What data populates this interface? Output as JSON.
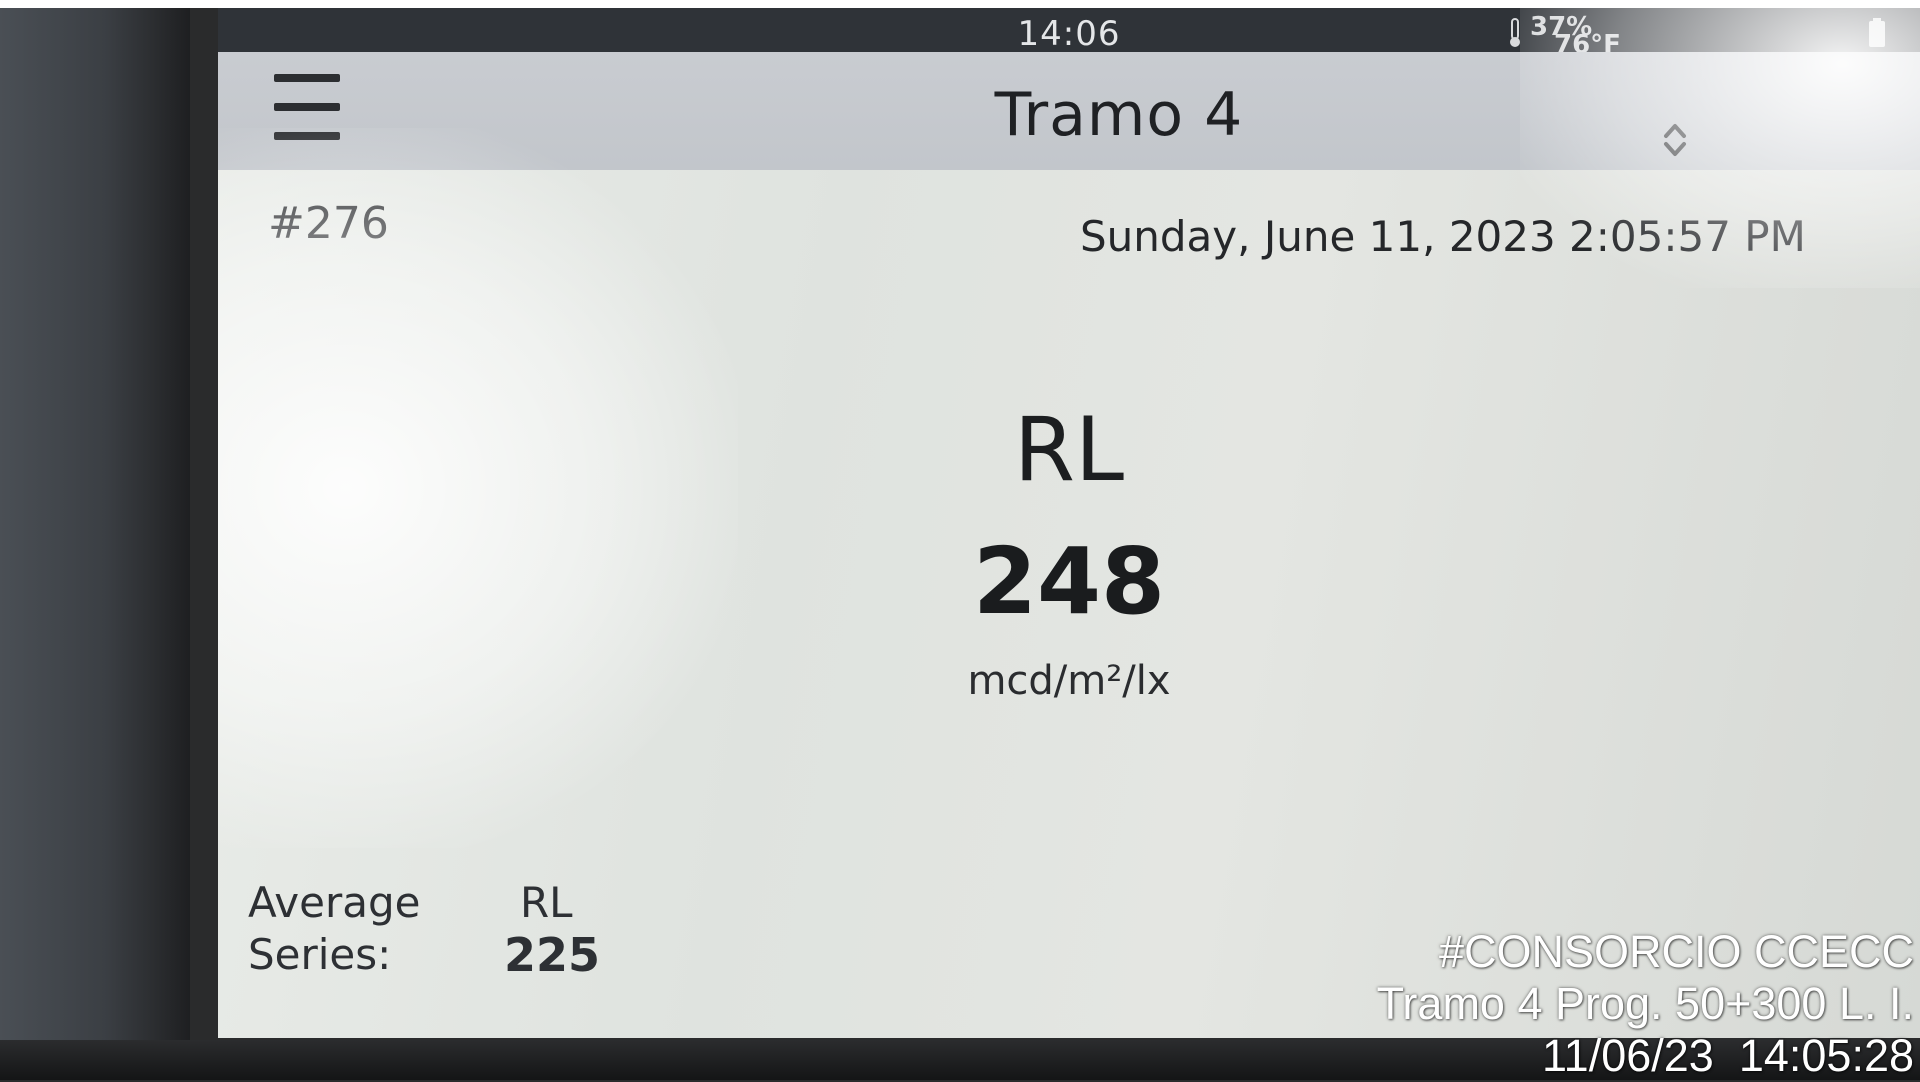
{
  "status_bar": {
    "time": "14:06",
    "humidity": "37%",
    "temperature": "76°F",
    "thermometer_icon": "thermometer-icon",
    "battery_icon": "battery-icon"
  },
  "header": {
    "title": "Tramo 4",
    "menu_icon": "hamburger-menu-icon",
    "switch_icon": "up-down-chevron-icon"
  },
  "measurement": {
    "record_number": "#276",
    "datetime": "Sunday, June 11, 2023 2:05:57 PM",
    "metric_label": "RL",
    "value": "248",
    "unit": "mcd/m²/lx"
  },
  "average": {
    "label_line1": "Average",
    "label_line2": "Series:",
    "metric": "RL",
    "value": "225"
  },
  "photo_stamp": {
    "line1": "#CONSORCIO CCECC",
    "line2": "Tramo 4 Prog. 50+300 L. I.",
    "line3": "11/06/23  14:05:28"
  },
  "colors": {
    "screen_background": "#e4e6e2",
    "title_bar": "#c6c9ce",
    "status_bar": "#2f3338",
    "text": "#1f2124"
  }
}
